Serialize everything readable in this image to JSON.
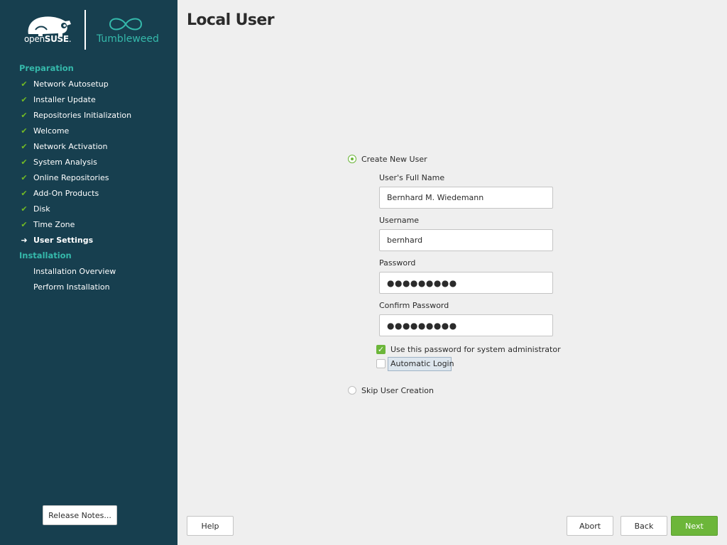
{
  "brand": {
    "suse_prefix": "open",
    "suse_bold": "SUSE",
    "suse_suffix": ".",
    "product": "Tumbleweed",
    "colors": {
      "sidebar_bg": "#173f4f",
      "accent_teal": "#35b9ab",
      "accent_green": "#6cb63a"
    }
  },
  "sidebar": {
    "sections": [
      {
        "heading": "Preparation",
        "steps": [
          {
            "label": "Network Autosetup",
            "status": "done"
          },
          {
            "label": "Installer Update",
            "status": "done"
          },
          {
            "label": "Repositories Initialization",
            "status": "done"
          },
          {
            "label": "Welcome",
            "status": "done"
          },
          {
            "label": "Network Activation",
            "status": "done"
          },
          {
            "label": "System Analysis",
            "status": "done"
          },
          {
            "label": "Online Repositories",
            "status": "done"
          },
          {
            "label": "Add-On Products",
            "status": "done"
          },
          {
            "label": "Disk",
            "status": "done"
          },
          {
            "label": "Time Zone",
            "status": "done"
          },
          {
            "label": "User Settings",
            "status": "current"
          }
        ]
      },
      {
        "heading": "Installation",
        "steps": [
          {
            "label": "Installation Overview",
            "status": "pending"
          },
          {
            "label": "Perform Installation",
            "status": "pending"
          }
        ]
      }
    ],
    "release_notes_button": "Release Notes..."
  },
  "page": {
    "title": "Local User",
    "create_user_radio": "Create New User",
    "create_user_selected": true,
    "full_name_label": "User's Full Name",
    "full_name_value": "Bernhard M. Wiedemann",
    "username_label": "Username",
    "username_value": "bernhard",
    "password_label": "Password",
    "password_value": "●●●●●●●●●",
    "confirm_password_label": "Confirm Password",
    "confirm_password_value": "●●●●●●●●●",
    "use_for_admin_label": "Use this password for system administrator",
    "use_for_admin_checked": true,
    "auto_login_label": "Automatic Login",
    "auto_login_checked": false,
    "skip_user_radio": "Skip User Creation",
    "skip_user_selected": false
  },
  "footer": {
    "help": "Help",
    "abort": "Abort",
    "back": "Back",
    "next": "Next"
  },
  "icons": {
    "done": "✔",
    "current": "➜",
    "checkbox_check": "✓"
  }
}
